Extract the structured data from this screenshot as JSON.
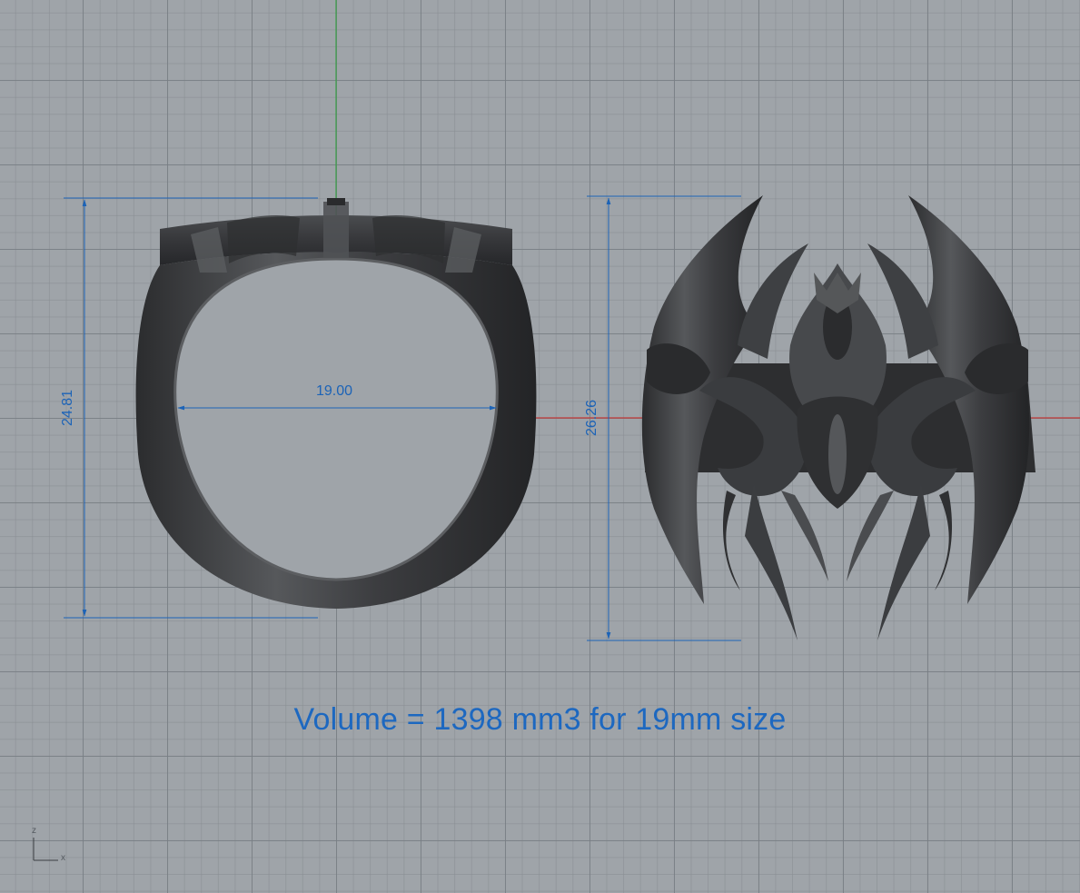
{
  "viewport": {
    "name": "front-view",
    "colors": {
      "background": "#9fa4a9",
      "grid_major": "#7e848a",
      "grid_minor": "#898e93",
      "x_axis": "#c23a3a",
      "y_axis": "#39a048",
      "dimension": "#1c63b7",
      "model": "#3a3b3d"
    }
  },
  "dimensions": {
    "side_height": "24.81",
    "inner_diameter": "19.00",
    "front_height": "26.26"
  },
  "caption": {
    "text": "Volume = 1398 mm3 for 19mm size"
  },
  "axis_icon": {
    "z_label": "z",
    "x_label": "x"
  }
}
